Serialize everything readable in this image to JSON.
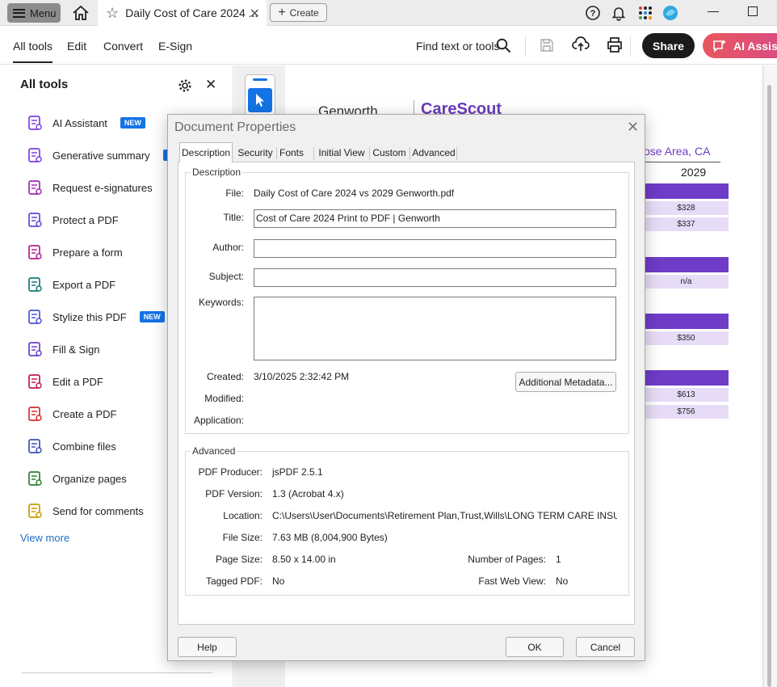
{
  "titlebar": {
    "menu_label": "Menu",
    "tab_title": "Daily Cost of Care 2024 ...",
    "create_label": "Create"
  },
  "toolbar": {
    "tabs": [
      "All tools",
      "Edit",
      "Convert",
      "E-Sign"
    ],
    "find_label": "Find text or tools",
    "share_label": "Share",
    "ai_label": "AI Assistant"
  },
  "leftpanel": {
    "title": "All tools",
    "tools": [
      {
        "label": "AI Assistant",
        "badge": "NEW",
        "icon": "ai-assistant-icon",
        "color": "#7b3fe4"
      },
      {
        "label": "Generative summary",
        "badge": "NEW",
        "icon": "generative-summary-icon",
        "color": "#7b3fe4"
      },
      {
        "label": "Request e-signatures",
        "badge": "",
        "icon": "request-esignature-icon",
        "color": "#9c2db0"
      },
      {
        "label": "Protect a PDF",
        "badge": "",
        "icon": "protect-pdf-icon",
        "color": "#5c4ad6"
      },
      {
        "label": "Prepare a form",
        "badge": "",
        "icon": "prepare-form-icon",
        "color": "#b0238f"
      },
      {
        "label": "Export a PDF",
        "badge": "",
        "icon": "export-pdf-icon",
        "color": "#127a76"
      },
      {
        "label": "Stylize this PDF",
        "badge": "NEW",
        "icon": "stylize-pdf-icon",
        "color": "#4b53d6"
      },
      {
        "label": "Fill & Sign",
        "badge": "",
        "icon": "fill-sign-icon",
        "color": "#6a3ec9"
      },
      {
        "label": "Edit a PDF",
        "badge": "",
        "icon": "edit-pdf-icon",
        "color": "#c2185b"
      },
      {
        "label": "Create a PDF",
        "badge": "",
        "icon": "create-pdf-icon",
        "color": "#d32f2f"
      },
      {
        "label": "Combine files",
        "badge": "",
        "icon": "combine-files-icon",
        "color": "#3f51b5"
      },
      {
        "label": "Organize pages",
        "badge": "",
        "icon": "organize-pages-icon",
        "color": "#2e7d32"
      },
      {
        "label": "Send for comments",
        "badge": "",
        "icon": "send-comments-icon",
        "color": "#c89b00"
      }
    ],
    "view_more": "View more"
  },
  "document": {
    "logo_genworth": "Genworth",
    "logo_carescout": "CareScout",
    "region": "ose Area, CA",
    "year": "2029",
    "cells": [
      "$328",
      "$337",
      "n/a",
      "$350",
      "$613",
      "$756"
    ]
  },
  "dialog": {
    "title": "Document Properties",
    "tabs": [
      "Description",
      "Security",
      "Fonts",
      "Initial View",
      "Custom",
      "Advanced"
    ],
    "description": {
      "group_label": "Description",
      "file_label": "File:",
      "file_value": "Daily Cost of Care 2024 vs 2029 Genworth.pdf",
      "title_label": "Title:",
      "title_value": "Cost of Care 2024 Print to PDF | Genworth",
      "author_label": "Author:",
      "author_value": "",
      "subject_label": "Subject:",
      "subject_value": "",
      "keywords_label": "Keywords:",
      "keywords_value": "",
      "created_label": "Created:",
      "created_value": "3/10/2025 2:32:42 PM",
      "modified_label": "Modified:",
      "modified_value": "",
      "application_label": "Application:",
      "application_value": "",
      "metadata_button": "Additional Metadata..."
    },
    "advanced": {
      "group_label": "Advanced",
      "producer_label": "PDF Producer:",
      "producer_value": "jsPDF 2.5.1",
      "version_label": "PDF Version:",
      "version_value": "1.3 (Acrobat 4.x)",
      "location_label": "Location:",
      "location_value": "C:\\Users\\User\\Documents\\Retirement Plan,Trust,Wills\\LONG TERM CARE INSURANCE\\",
      "filesize_label": "File Size:",
      "filesize_value": "7.63 MB (8,004,900 Bytes)",
      "pagesize_label": "Page Size:",
      "pagesize_value": "8.50 x 14.00 in",
      "numpages_label": "Number of Pages:",
      "numpages_value": "1",
      "tagged_label": "Tagged PDF:",
      "tagged_value": "No",
      "fastweb_label": "Fast Web View:",
      "fastweb_value": "No"
    },
    "buttons": {
      "help": "Help",
      "ok": "OK",
      "cancel": "Cancel"
    }
  }
}
